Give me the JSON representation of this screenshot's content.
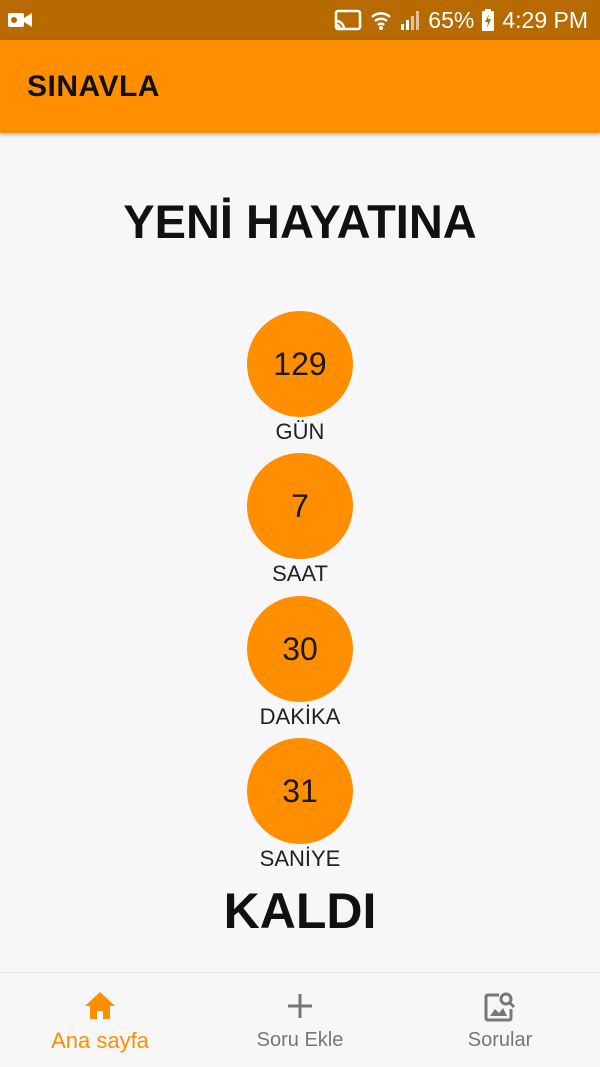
{
  "status_bar": {
    "battery": "65%",
    "time": "4:29 PM",
    "icons": [
      "video-camera-icon",
      "cast-icon",
      "wifi-icon",
      "signal-icon",
      "battery-charging-icon"
    ]
  },
  "app_bar": {
    "title": "SINAVLA"
  },
  "main": {
    "headline": "YENİ HAYATINA",
    "footer_headline": "KALDI",
    "counters": [
      {
        "value": "129",
        "label": "GÜN"
      },
      {
        "value": "7",
        "label": "SAAT"
      },
      {
        "value": "30",
        "label": "DAKİKA"
      },
      {
        "value": "31",
        "label": "SANİYE"
      }
    ],
    "accent_color": "#ff8f00"
  },
  "bottom_nav": {
    "items": [
      {
        "label": "Ana sayfa",
        "icon": "home-icon",
        "active": true
      },
      {
        "label": "Soru Ekle",
        "icon": "plus-icon",
        "active": false
      },
      {
        "label": "Sorular",
        "icon": "image-search-icon",
        "active": false
      }
    ]
  }
}
